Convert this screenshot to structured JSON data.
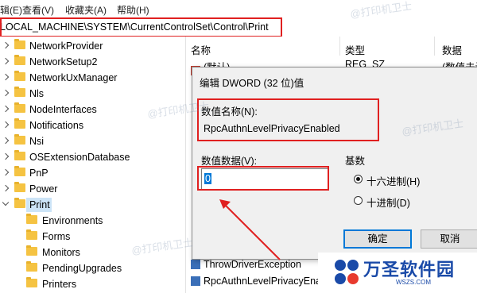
{
  "menu": [
    {
      "label": "辑(E)"
    },
    {
      "label": "查看(V)"
    },
    {
      "label": "收藏夹(A)"
    },
    {
      "label": "帮助(H)"
    }
  ],
  "address": "LOCAL_MACHINE\\SYSTEM\\CurrentControlSet\\Control\\Print",
  "tree": {
    "items": [
      {
        "label": "NetworkProvider",
        "expanded": false,
        "selected": false
      },
      {
        "label": "NetworkSetup2",
        "expanded": false,
        "selected": false
      },
      {
        "label": "NetworkUxManager",
        "expanded": false,
        "selected": false
      },
      {
        "label": "Nls",
        "expanded": false,
        "selected": false
      },
      {
        "label": "NodeInterfaces",
        "expanded": false,
        "selected": false
      },
      {
        "label": "Notifications",
        "expanded": false,
        "selected": false
      },
      {
        "label": "Nsi",
        "expanded": false,
        "selected": false
      },
      {
        "label": "OSExtensionDatabase",
        "expanded": false,
        "selected": false
      },
      {
        "label": "PnP",
        "expanded": false,
        "selected": false
      },
      {
        "label": "Power",
        "expanded": false,
        "selected": false
      },
      {
        "label": "Print",
        "expanded": true,
        "selected": true
      },
      {
        "label": "Environments",
        "child": true
      },
      {
        "label": "Forms",
        "child": true
      },
      {
        "label": "Monitors",
        "child": true
      },
      {
        "label": "PendingUpgrades",
        "child": true
      },
      {
        "label": "Printers",
        "child": true
      }
    ]
  },
  "pane": {
    "columns": {
      "name": "名称",
      "type": "类型",
      "data": "数据"
    },
    "rows": [
      {
        "name": "(默认)",
        "type": "REG_SZ",
        "data": "(数值未设"
      },
      {
        "name": "ThrowDriverException",
        "type": "",
        "data": ""
      },
      {
        "name": "RpcAuthnLevelPrivacyEnab",
        "type": "",
        "data": ""
      }
    ]
  },
  "dialog": {
    "title": "编辑 DWORD (32 位)值",
    "name_label": "数值名称(N):",
    "name_value": "RpcAuthnLevelPrivacyEnabled",
    "data_label": "数值数据(V):",
    "data_value": "0",
    "base_label": "基数",
    "hex_label": "十六进制(H)",
    "dec_label": "十进制(D)",
    "selected_base": "hex",
    "ok_label": "确定",
    "cancel_label": "取消"
  },
  "watermark": "@打印机卫士",
  "logo": {
    "title": "万圣软件园",
    "sub": "WSZS.COM"
  },
  "colors": {
    "highlight_red": "#e02020",
    "selection_blue": "#cce4f7",
    "folder_yellow": "#f5c342",
    "logo_blue": "#1a4aa8"
  }
}
